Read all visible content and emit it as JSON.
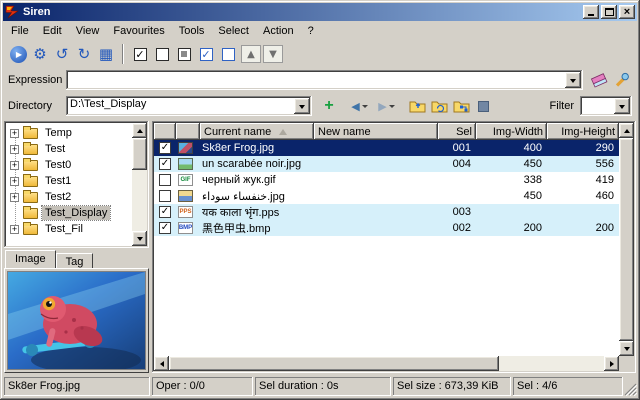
{
  "window": {
    "title": "Siren"
  },
  "titlebar": {
    "close_glyph": "×"
  },
  "menu": {
    "items": [
      "File",
      "Edit",
      "View",
      "Favourites",
      "Tools",
      "Select",
      "Action",
      "?"
    ]
  },
  "toolbar": {
    "buttons": [
      {
        "name": "rename",
        "glyph": "▶"
      },
      {
        "name": "options",
        "glyph": "⚙"
      },
      {
        "name": "undo",
        "glyph": "↺"
      },
      {
        "name": "redo",
        "glyph": "↻"
      },
      {
        "name": "keypad",
        "glyph": "▦"
      }
    ],
    "check_glyph": "✓",
    "select_buttons": [
      "select-all",
      "unselect-all",
      "invert-selection",
      "check-matching",
      "uncheck-matching"
    ],
    "sort_buttons": [
      {
        "name": "move-up",
        "glyph": "▲"
      },
      {
        "name": "move-down",
        "glyph": "▼"
      }
    ]
  },
  "expression": {
    "label": "Expression",
    "value": ""
  },
  "directory": {
    "label": "Directory",
    "value": "D:\\Test_Display",
    "plus_glyph": "+",
    "back_glyph": "◀",
    "forward_glyph": "▶",
    "filter_label": "Filter",
    "filter_value": ""
  },
  "tree": {
    "items": [
      {
        "label": "Temp",
        "expander": "+"
      },
      {
        "label": "Test",
        "expander": "+"
      },
      {
        "label": "Test0",
        "expander": "+"
      },
      {
        "label": "Test1",
        "expander": "+"
      },
      {
        "label": "Test2",
        "expander": "+"
      },
      {
        "label": "Test_Display",
        "expander": "",
        "selected": true
      },
      {
        "label": "Test_Fil",
        "expander": "+"
      }
    ]
  },
  "preview": {
    "tabs": [
      "Image",
      "Tag"
    ],
    "active_tab": "Image"
  },
  "list": {
    "columns": [
      "",
      "",
      "Current name",
      "New name",
      "Sel",
      "Img-Width",
      "Img-Height"
    ],
    "sort": {
      "column": "Current name",
      "direction": "ascending"
    },
    "rows": [
      {
        "check": "✓",
        "name": "Sk8er Frog.jpg",
        "new_name": "",
        "sel": "001",
        "width": "400",
        "height": "290",
        "icon": "jpg-thumbnail",
        "selected": true
      },
      {
        "check": "✓",
        "name": "un scarabée noir.jpg",
        "new_name": "",
        "sel": "004",
        "width": "450",
        "height": "556",
        "icon": "jpg-picture"
      },
      {
        "check": "",
        "name": "черный жук.gif",
        "new_name": "",
        "sel": "",
        "width": "338",
        "height": "419",
        "icon": "gif",
        "badge": "GIF"
      },
      {
        "check": "",
        "name": "خنفساء سوداء.jpg",
        "new_name": "",
        "sel": "",
        "width": "450",
        "height": "460",
        "icon": "jpg-picture-2"
      },
      {
        "check": "✓",
        "name": "यक काला भृंग.pps",
        "new_name": "",
        "sel": "003",
        "width": "",
        "height": "",
        "icon": "pps",
        "badge": "PPS"
      },
      {
        "check": "✓",
        "name": "黑色甲虫.bmp",
        "new_name": "",
        "sel": "002",
        "width": "200",
        "height": "200",
        "icon": "bmp",
        "badge": "BMP"
      }
    ]
  },
  "statusbar": {
    "file": "Sk8er Frog.jpg",
    "oper": "Oper : 0/0",
    "duration": "Sel duration : 0s",
    "size": "Sel size : 673,39 KiB",
    "selection": "Sel : 4/6"
  }
}
